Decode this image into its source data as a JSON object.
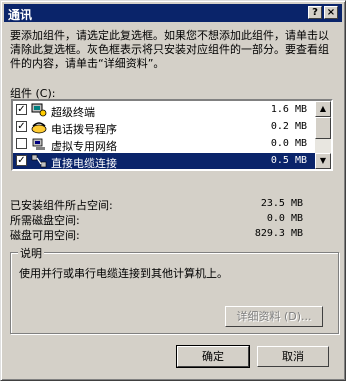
{
  "window": {
    "title": "通讯",
    "help_label": "?",
    "close_label": "×"
  },
  "intro": "要添加组件，请选定此复选框。如果您不想添加此组件，请单击以清除此复选框。灰色框表示将只安装对应组件的一部分。要查看组件的内容，请单击“详细资料”。",
  "components_label": "组件 (C):",
  "components": [
    {
      "name": "超级终端",
      "size": "1.6 MB",
      "checked": true,
      "icon": "terminal-icon"
    },
    {
      "name": "电话拨号程序",
      "size": "0.2 MB",
      "checked": true,
      "icon": "phone-dialer-icon"
    },
    {
      "name": "虚拟专用网络",
      "size": "0.0 MB",
      "checked": false,
      "icon": "vpn-icon"
    },
    {
      "name": "直接电缆连接",
      "size": "0.5 MB",
      "checked": true,
      "icon": "direct-cable-icon",
      "selected": true
    }
  ],
  "stats": [
    {
      "label": "已安装组件所占空间:",
      "value": "23.5 MB"
    },
    {
      "label": "所需磁盘空间:",
      "value": "0.0 MB"
    },
    {
      "label": "磁盘可用空间:",
      "value": "829.3 MB"
    }
  ],
  "description": {
    "title": "说明",
    "text": "使用并行或串行电缆连接到其他计算机上。"
  },
  "details_button": "详细资料 (D)...",
  "ok_button": "确定",
  "cancel_button": "取消",
  "colors": {
    "selection": "#0a246a",
    "face": "#d4d0c8"
  }
}
